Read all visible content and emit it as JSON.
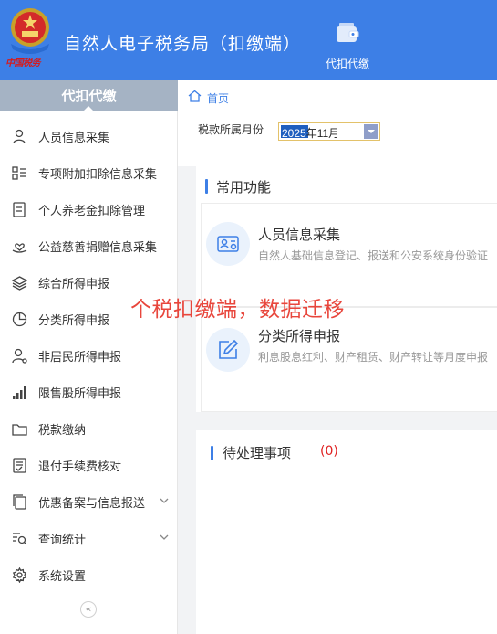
{
  "header": {
    "emblem_text": "中国税务",
    "app_title": "自然人电子税务局（扣缴端）",
    "nav_item": {
      "label": "代扣代缴",
      "icon": "wallet-icon"
    },
    "background_color": "#3d7fe6"
  },
  "sidebar": {
    "title": "代扣代缴",
    "items": [
      {
        "label": "人员信息采集",
        "icon": "person-icon"
      },
      {
        "label": "专项附加扣除信息采集",
        "icon": "list-icon"
      },
      {
        "label": "个人养老金扣除管理",
        "icon": "document-icon"
      },
      {
        "label": "公益慈善捐赠信息采集",
        "icon": "charity-icon"
      },
      {
        "label": "综合所得申报",
        "icon": "layers-icon"
      },
      {
        "label": "分类所得申报",
        "icon": "pie-chart-icon"
      },
      {
        "label": "非居民所得申报",
        "icon": "nonresident-icon"
      },
      {
        "label": "限售股所得申报",
        "icon": "bar-chart-icon"
      },
      {
        "label": "税款缴纳",
        "icon": "folder-icon"
      },
      {
        "label": "退付手续费核对",
        "icon": "checklist-icon"
      },
      {
        "label": "优惠备案与信息报送",
        "icon": "copy-icon",
        "expandable": true
      },
      {
        "label": "查询统计",
        "icon": "search-list-icon",
        "expandable": true
      },
      {
        "label": "系统设置",
        "icon": "gear-icon"
      }
    ],
    "collapse_glyph": "«"
  },
  "breadcrumb": {
    "label": "首页"
  },
  "filter": {
    "label": "税款所属月份",
    "value_selected": "2025",
    "value_rest": "年11月"
  },
  "common_functions": {
    "title": "常用功能",
    "items": [
      {
        "title": "人员信息采集",
        "desc": "自然人基础信息登记、报送和公安系统身份验证",
        "icon": "id-card-icon"
      },
      {
        "title": "分类所得申报",
        "desc": "利息股息红利、财产租赁、财产转让等月度申报",
        "icon": "edit-icon"
      }
    ]
  },
  "pending": {
    "title": "待处理事项",
    "count": "(0)"
  },
  "overlay_text": "个税扣缴端，数据迁移",
  "colors": {
    "accent": "#3d7fe6",
    "sidebar_head": "#a5b3c4",
    "alert": "#e02020",
    "overlay": "#e8463c"
  }
}
